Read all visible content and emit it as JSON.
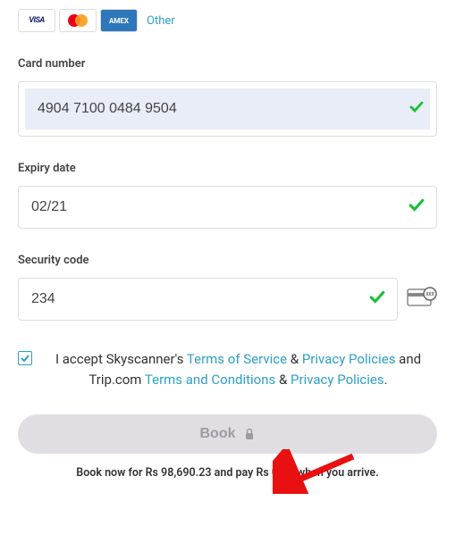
{
  "card_logos": {
    "visa": "VISA",
    "amex": "AMEX",
    "other_link": "Other"
  },
  "card_number": {
    "label": "Card number",
    "value": "4904 7100 0484 9504"
  },
  "expiry": {
    "label": "Expiry date",
    "value": "02/21"
  },
  "cvv": {
    "label": "Security code",
    "value": "234"
  },
  "terms": {
    "prefix": "I accept Skyscanner's ",
    "tos": "Terms of Service",
    "amp1": " & ",
    "privacy1": "Privacy Policies",
    "mid": " and Trip.com ",
    "tac": "Terms and Conditions",
    "amp2": " & ",
    "privacy2": "Privacy Policies",
    "dot": "."
  },
  "book": {
    "label": "Book",
    "subtitle": "Book now for Rs 98,690.23 and pay Rs 0.00 when you arrive."
  }
}
